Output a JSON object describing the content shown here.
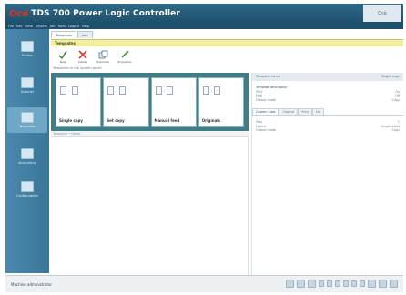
{
  "window": {
    "brand": "Océ",
    "title": "TDS 700 Power Logic Controller",
    "corner_logo": "Océ"
  },
  "menubar": [
    "File",
    "Edit",
    "View",
    "System",
    "Job",
    "Tools",
    "Logout",
    "Help"
  ],
  "sidebar": {
    "items": [
      {
        "label": "Printer",
        "icon": "printer-icon"
      },
      {
        "label": "Scanner",
        "icon": "scanner-icon"
      },
      {
        "label": "Templates",
        "icon": "templates-icon",
        "active": true
      },
      {
        "label": "Accounting",
        "icon": "accounting-icon"
      },
      {
        "label": "Configuration",
        "icon": "configuration-icon"
      }
    ]
  },
  "top_tabs": [
    "Templates",
    "Jobs"
  ],
  "section": {
    "title": "Templates"
  },
  "toolbar": [
    {
      "label": "New",
      "icon": "checkmark-icon"
    },
    {
      "label": "Delete",
      "icon": "delete-x-icon"
    },
    {
      "label": "Duplicate",
      "icon": "duplicate-icon"
    },
    {
      "label": "Properties",
      "icon": "properties-icon"
    }
  ],
  "description": "Templates in the system panel",
  "cards": [
    "Single copy",
    "Set copy",
    "Manual feed",
    "Originals"
  ],
  "list": {
    "header": "Template • Name"
  },
  "right_panel": {
    "header": {
      "key": "Template name",
      "value": "Single copy"
    },
    "properties": [
      {
        "key": "Template description",
        "value": "",
        "bold": true
      },
      {
        "key": "Print",
        "value": "On"
      },
      {
        "key": "Fold",
        "value": "Off"
      },
      {
        "key": "Output mode",
        "value": "Copy"
      }
    ],
    "tabs": [
      "Custom Card",
      "Original",
      "Print",
      "File"
    ],
    "tab_properties": [
      {
        "key": "Sets",
        "value": "1"
      },
      {
        "key": "Output",
        "value": "Single sheet"
      },
      {
        "key": "Output mode",
        "value": "Copy"
      }
    ]
  },
  "status": {
    "user": "Machine administrator"
  },
  "colors": {
    "title_bar": "#2f6a8a",
    "sidebar": "#4a89ad",
    "section_header": "#f3ef9d",
    "carousel": "#3f7e86",
    "brand_red": "#e8321e"
  }
}
